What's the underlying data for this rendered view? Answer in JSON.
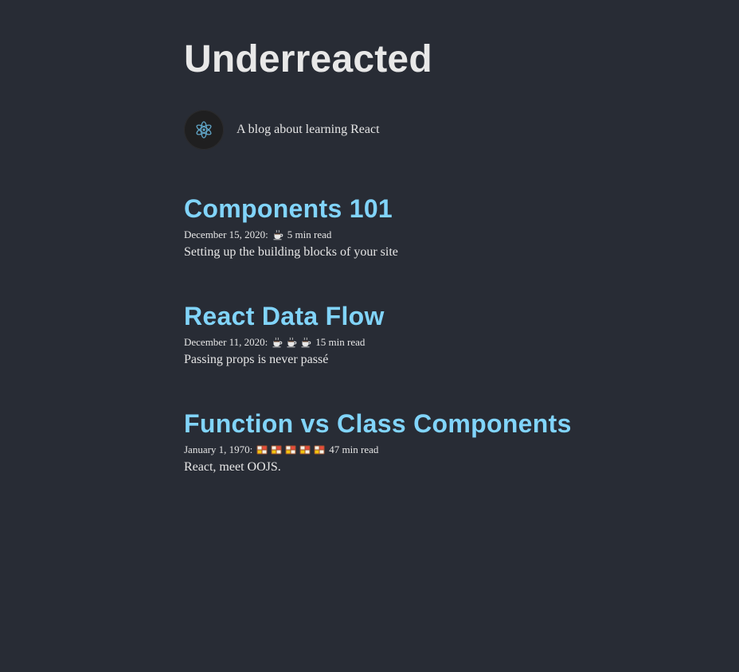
{
  "header": {
    "title": "Underreacted"
  },
  "bio": {
    "avatar_icon": "react-atom-icon",
    "text": "A blog about learning React"
  },
  "posts": [
    {
      "title": "Components 101",
      "date": "December 15, 2020:",
      "read_icon": "coffee-cup-icon",
      "read_icon_count": 1,
      "read_time": "5 min read",
      "description": "Setting up the building blocks of your site"
    },
    {
      "title": "React Data Flow",
      "date": "December 11, 2020:",
      "read_icon": "coffee-cup-icon",
      "read_icon_count": 3,
      "read_time": "15 min read",
      "description": "Passing props is never passé"
    },
    {
      "title": "Function vs Class Components",
      "date": "January 1, 1970:",
      "read_icon": "bento-box-icon",
      "read_icon_count": 5,
      "read_time": "47 min read",
      "description": "React, meet OOJS."
    }
  ],
  "colors": {
    "background": "#282c35",
    "title": "#e8e8e8",
    "link": "#81d4fa",
    "text": "#e6e6e6"
  }
}
